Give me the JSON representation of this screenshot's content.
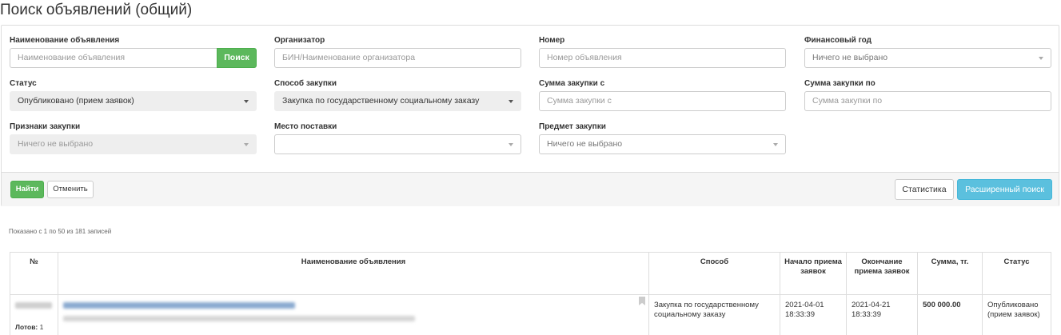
{
  "page": {
    "title": "Поиск объявлений (общий)"
  },
  "filters": {
    "name": {
      "label": "Наименование объявления",
      "placeholder": "Наименование объявления",
      "search_button": "Поиск"
    },
    "organizer": {
      "label": "Организатор",
      "placeholder": "БИН/Наименование организатора"
    },
    "number": {
      "label": "Номер",
      "placeholder": "Номер объявления"
    },
    "fiscal_year": {
      "label": "Финансовый год",
      "value": "Ничего не выбрано"
    },
    "status": {
      "label": "Статус",
      "value": "Опубликовано (прием заявок)"
    },
    "method": {
      "label": "Способ закупки",
      "value": "Закупка по государственному социальному заказу"
    },
    "amount_from": {
      "label": "Сумма закупки с",
      "placeholder": "Сумма закупки с"
    },
    "amount_to": {
      "label": "Сумма закупки по",
      "placeholder": "Сумма закупки по"
    },
    "features": {
      "label": "Признаки закупки",
      "value": "Ничего не выбрано"
    },
    "delivery_place": {
      "label": "Место поставки",
      "value": ""
    },
    "subject": {
      "label": "Предмет закупки",
      "value": "Ничего не выбрано"
    }
  },
  "actions": {
    "find": "Найти",
    "cancel": "Отменить",
    "statistics": "Статистика",
    "advanced": "Расширенный поиск"
  },
  "results": {
    "info": "Показано с 1 по 50 из 181 записей",
    "columns": [
      "№",
      "Наименование объявления",
      "Способ",
      "Начало приема заявок",
      "Окончание приема заявок",
      "Сумма, тг.",
      "Статус"
    ],
    "rows": [
      {
        "lots_label": "Лотов:",
        "lots_count": "1",
        "method": "Закупка по государственному социальному заказу",
        "start": "2021-04-01 18:33:39",
        "end": "2021-04-21 18:33:39",
        "amount": "500 000.00",
        "status": "Опубликовано (прием заявок)"
      }
    ]
  },
  "icons": {
    "cursor": "mouse-pointer-icon",
    "caret": "caret-down-icon",
    "bookmark": "bookmark-icon"
  },
  "colors": {
    "success": "#5cb85c",
    "info": "#5bc0de",
    "link": "#337ab7"
  }
}
